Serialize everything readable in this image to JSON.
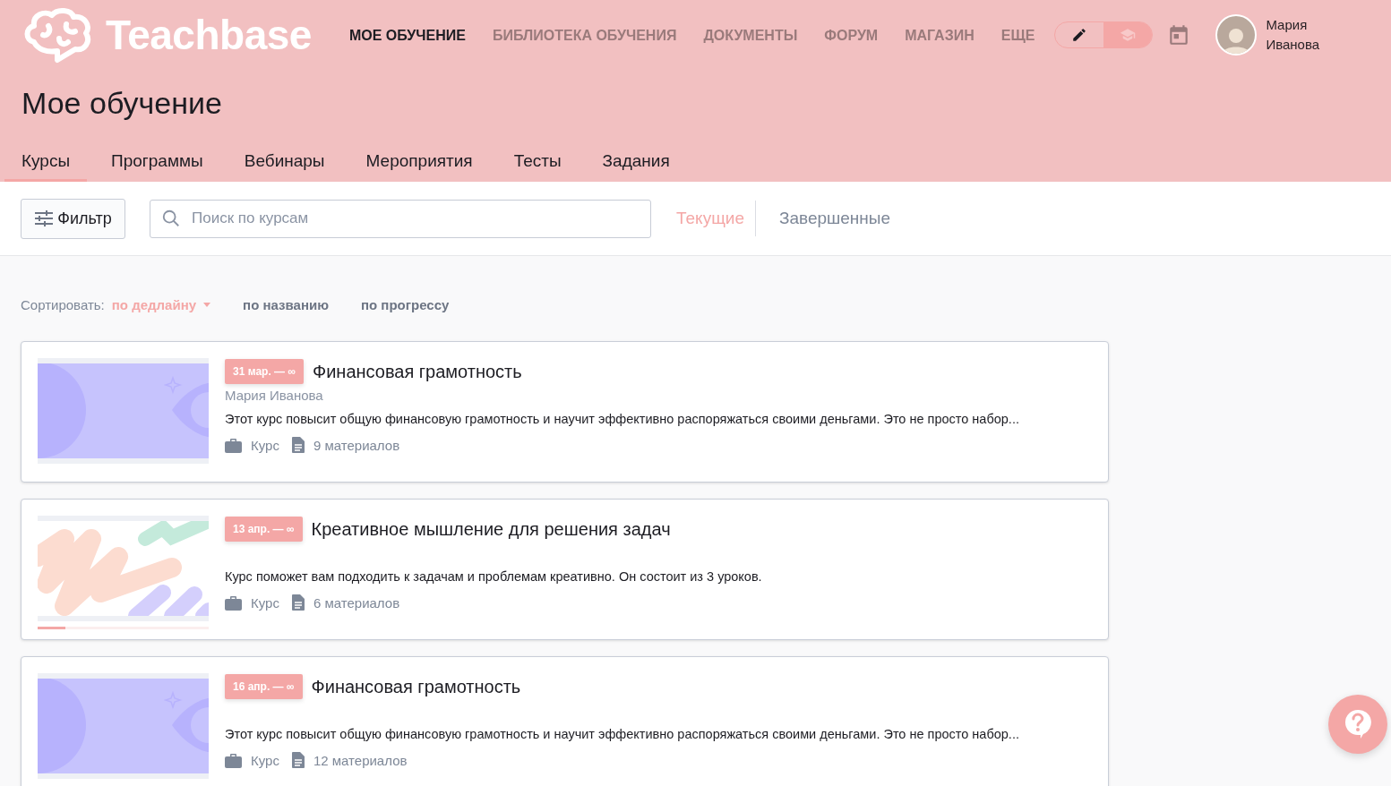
{
  "header": {
    "logo": "Teachbase",
    "nav": [
      {
        "label": "МОЕ ОБУЧЕНИЕ",
        "selected": true
      },
      {
        "label": "БИБЛИОТЕКА ОБУЧЕНИЯ",
        "selected": false
      },
      {
        "label": "ДОКУМЕНТЫ",
        "selected": false
      },
      {
        "label": "ФОРУМ",
        "selected": false
      },
      {
        "label": "МАГАЗИН",
        "selected": false
      },
      {
        "label": "ЕЩЕ",
        "selected": false
      }
    ],
    "modes": [
      {
        "kind": "edit",
        "selected": false
      },
      {
        "kind": "learn",
        "selected": true
      }
    ],
    "user": "Мария Иванова"
  },
  "page_title": "Мое обучение",
  "tabs": [
    {
      "label": "Курсы",
      "selected": true
    },
    {
      "label": "Программы",
      "selected": false
    },
    {
      "label": "Вебинары",
      "selected": false
    },
    {
      "label": "Мероприятия",
      "selected": false
    },
    {
      "label": "Тесты",
      "selected": false
    },
    {
      "label": "Задания",
      "selected": false
    }
  ],
  "toolbar": {
    "filter": "Фильтр",
    "search": {
      "placeholder": "Поиск по курсам"
    },
    "status": [
      {
        "label": "Текущие",
        "selected": true
      },
      {
        "label": "Завершенные",
        "selected": false
      }
    ]
  },
  "sort": {
    "label": "Сортировать:",
    "options": [
      {
        "label": "по дедлайну",
        "selected": true
      },
      {
        "label": "по названию",
        "selected": false
      },
      {
        "label": "по прогрессу",
        "selected": false
      }
    ]
  },
  "courses": [
    {
      "thumbnail": {
        "kind": "eye"
      },
      "date": "31 мар. — ∞",
      "title": "Финансовая грамотность",
      "author": "Мария Иванова",
      "description": "Этот курс повысит общую финансовую грамотность и научит эффективно распоряжаться своими деньгами. Это не просто набор...",
      "type": "Курс",
      "materials": "9 материалов"
    },
    {
      "thumbnail": {
        "kind": "strokes"
      },
      "progress": {
        "level": 0.16
      },
      "date": "13 апр. — ∞",
      "title": "Креативное мышление для решения задач",
      "description": "Курс поможет вам подходить к задачам и проблемам креативно. Он состоит из 3 уроков.",
      "type": "Курс",
      "materials": "6 материалов"
    },
    {
      "thumbnail": {
        "kind": "eye"
      },
      "date": "16 апр. — ∞",
      "title": "Финансовая грамотность",
      "description": "Этот курс повысит общую финансовую грамотность и научит эффективно распоряжаться своими деньгами. Это не просто набор...",
      "type": "Курс",
      "materials": "12 материалов"
    }
  ]
}
